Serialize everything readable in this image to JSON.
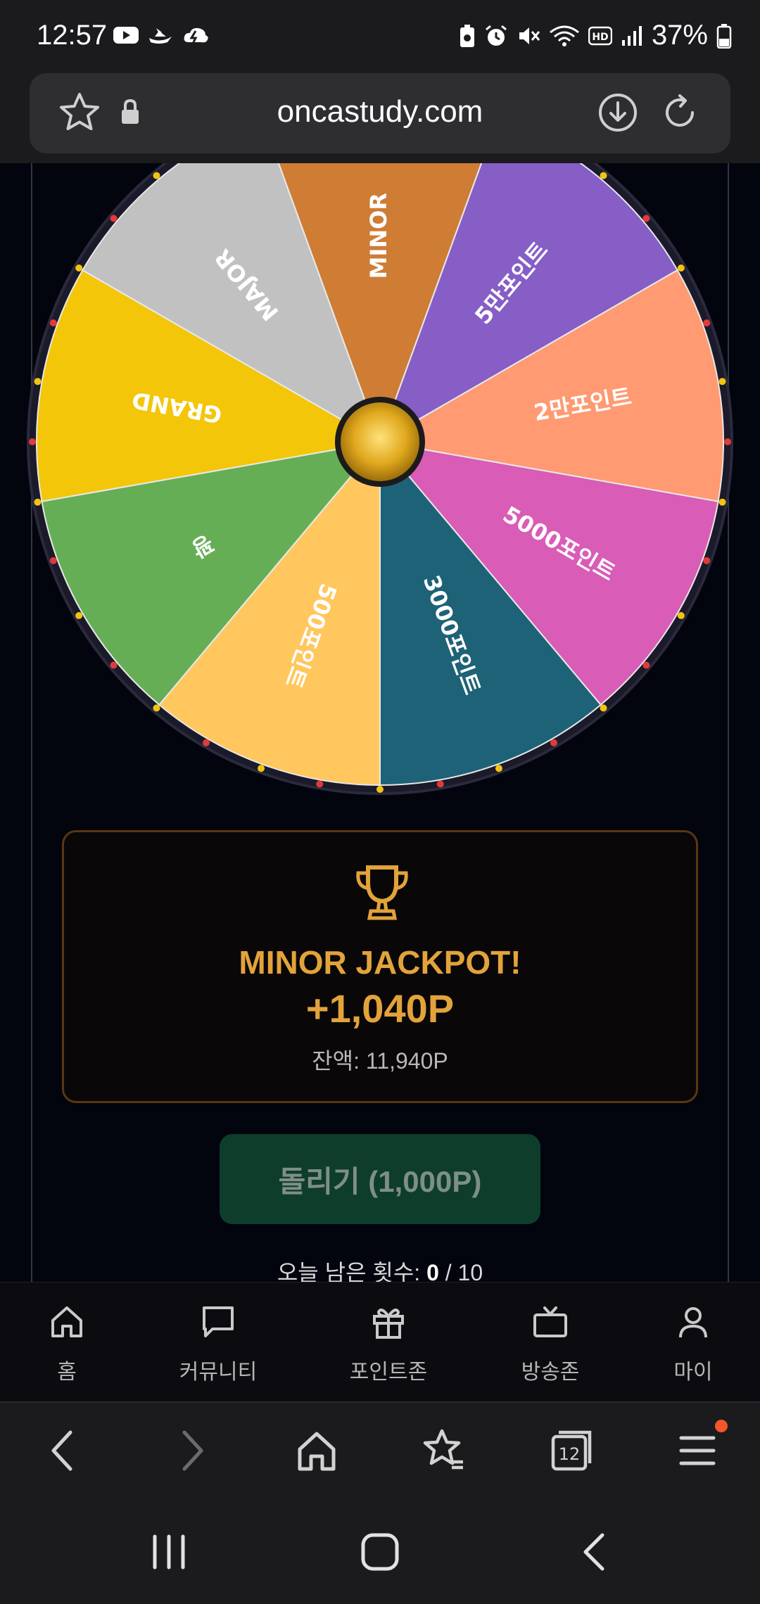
{
  "status_bar": {
    "time": "12:57",
    "battery_percent": "37%",
    "icons": [
      "youtube-icon",
      "boat-icon",
      "cloud-icon",
      "battery-saver-icon",
      "alarm-icon",
      "mute-icon",
      "wifi-icon",
      "hd-icon",
      "signal-icon",
      "battery-icon"
    ]
  },
  "browser": {
    "url": "oncastudy.com",
    "tab_count": "12"
  },
  "wheel": {
    "segments": [
      {
        "label": "MINOR",
        "color": "#cf7c35"
      },
      {
        "label": "5만포인트",
        "color": "#865ec6"
      },
      {
        "label": "2만포인트",
        "color": "#ff9a72"
      },
      {
        "label": "5000포인트",
        "color": "#d95cb7"
      },
      {
        "label": "3000포인트",
        "color": "#1e6277"
      },
      {
        "label": "500포인트",
        "color": "#ffc75e"
      },
      {
        "label": "꽝",
        "color": "#66ae55"
      },
      {
        "label": "GRAND",
        "color": "#f3c609"
      },
      {
        "label": "MAJOR",
        "color": "#c1c1c1"
      }
    ]
  },
  "result": {
    "title": "MINOR JACKPOT!",
    "points": "+1,040P",
    "balance": "잔액: 11,940P"
  },
  "spin_button": {
    "label": "돌리기 (1,000P)"
  },
  "remaining": {
    "prefix": "오늘 남은 횟수: ",
    "used": "0",
    "suffix": " / 10"
  },
  "site_nav": {
    "items": [
      {
        "label": "홈",
        "icon": "home-icon"
      },
      {
        "label": "커뮤니티",
        "icon": "chat-icon"
      },
      {
        "label": "포인트존",
        "icon": "gift-icon"
      },
      {
        "label": "방송존",
        "icon": "tv-icon"
      },
      {
        "label": "마이",
        "icon": "user-icon"
      }
    ]
  },
  "colors": {
    "accent": "#e2a33a",
    "page_bg": "#02040e",
    "button_bg": "#0f3d2c"
  }
}
